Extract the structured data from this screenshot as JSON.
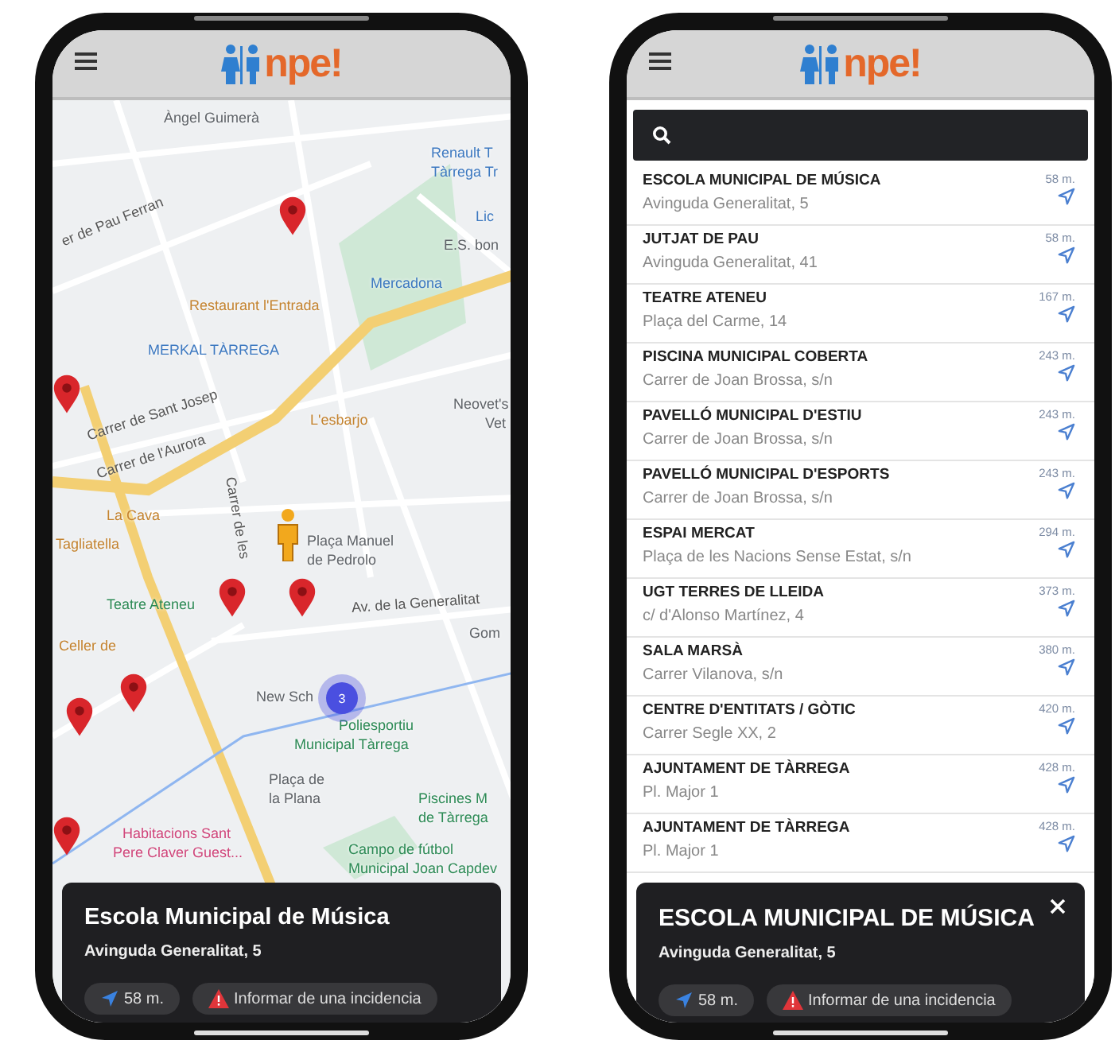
{
  "phones": [
    {
      "kind": "map",
      "logo": "npe!",
      "map": {
        "cluster": "3",
        "labels": [
          {
            "text": "Àngel Guimerà",
            "kind": "place"
          },
          {
            "text": "Renault T",
            "kind": "shop"
          },
          {
            "text": "Tàrrega Tr",
            "kind": "shop"
          },
          {
            "text": "Lic",
            "kind": "shop"
          },
          {
            "text": "E.S. bon",
            "kind": "place"
          },
          {
            "text": "er de Pau Ferran",
            "kind": "street"
          },
          {
            "text": "Restaurant l'Entrada",
            "kind": "food"
          },
          {
            "text": "Mercadona",
            "kind": "shop"
          },
          {
            "text": "MERKAL TÀRREGA",
            "kind": "shop"
          },
          {
            "text": "Carrer de Sant Josep",
            "kind": "street"
          },
          {
            "text": "Carrer de l'Aurora",
            "kind": "street"
          },
          {
            "text": "L'esbarjo",
            "kind": "food"
          },
          {
            "text": "Neovet's",
            "kind": "place"
          },
          {
            "text": "Vet",
            "kind": "place"
          },
          {
            "text": "Carrer de les",
            "kind": "street"
          },
          {
            "text": "La Cava",
            "kind": "food"
          },
          {
            "text": "Plaça Manuel",
            "kind": "place"
          },
          {
            "text": "de Pedrolo",
            "kind": "place"
          },
          {
            "text": "Tagliatella",
            "kind": "food"
          },
          {
            "text": "Teatre Ateneu",
            "kind": "park"
          },
          {
            "text": "Av. de la Generalitat",
            "kind": "street"
          },
          {
            "text": "Gom",
            "kind": "place"
          },
          {
            "text": "Celler de",
            "kind": "food"
          },
          {
            "text": "New Sch",
            "kind": "place"
          },
          {
            "text": "Poliesportiu",
            "kind": "park"
          },
          {
            "text": "Municipal Tàrrega",
            "kind": "park"
          },
          {
            "text": "Plaça de",
            "kind": "place"
          },
          {
            "text": "la Plana",
            "kind": "place"
          },
          {
            "text": "Piscines M",
            "kind": "park"
          },
          {
            "text": "de Tàrrega",
            "kind": "park"
          },
          {
            "text": "Habitacions Sant",
            "kind": "hotel"
          },
          {
            "text": "Pere Claver Guest...",
            "kind": "hotel"
          },
          {
            "text": "Campo de fútbol",
            "kind": "park"
          },
          {
            "text": "Municipal Joan Capdev",
            "kind": "park"
          }
        ]
      },
      "card": {
        "title": "Escola Municipal de Música",
        "address": "Avinguda Generalitat, 5",
        "distance": "58 m.",
        "report": "Informar de una incidencia",
        "closable": false
      }
    },
    {
      "kind": "list",
      "logo": "npe!",
      "places": [
        {
          "name": "ESCOLA MUNICIPAL DE MÚSICA",
          "address": "Avinguda Generalitat, 5",
          "distance": "58 m."
        },
        {
          "name": "JUTJAT DE PAU",
          "address": "Avinguda Generalitat, 41",
          "distance": "58 m."
        },
        {
          "name": "TEATRE ATENEU",
          "address": "Plaça del Carme, 14",
          "distance": "167 m."
        },
        {
          "name": "PISCINA MUNICIPAL COBERTA",
          "address": "Carrer de Joan Brossa, s/n",
          "distance": "243 m."
        },
        {
          "name": "PAVELLÓ MUNICIPAL D'ESTIU",
          "address": "Carrer de Joan Brossa, s/n",
          "distance": "243 m."
        },
        {
          "name": "PAVELLÓ MUNICIPAL D'ESPORTS",
          "address": "Carrer de Joan Brossa, s/n",
          "distance": "243 m."
        },
        {
          "name": "ESPAI MERCAT",
          "address": "Plaça de les Nacions Sense Estat, s/n",
          "distance": "294 m."
        },
        {
          "name": "UGT TERRES DE LLEIDA",
          "address": "c/ d'Alonso Martínez, 4",
          "distance": "373 m."
        },
        {
          "name": "SALA MARSÀ",
          "address": "Carrer Vilanova, s/n",
          "distance": "380 m."
        },
        {
          "name": "CENTRE D'ENTITATS / GÒTIC",
          "address": "Carrer Segle XX, 2",
          "distance": "420 m."
        },
        {
          "name": "AJUNTAMENT DE TÀRREGA",
          "address": "Pl. Major 1",
          "distance": "428 m."
        },
        {
          "name": "AJUNTAMENT DE TÀRREGA",
          "address": "Pl. Major 1",
          "distance": "428 m."
        }
      ],
      "card": {
        "title": "ESCOLA MUNICIPAL DE MÚSICA",
        "address": "Avinguda Generalitat, 5",
        "distance": "58 m.",
        "report": "Informar de una incidencia",
        "closable": true
      }
    }
  ]
}
